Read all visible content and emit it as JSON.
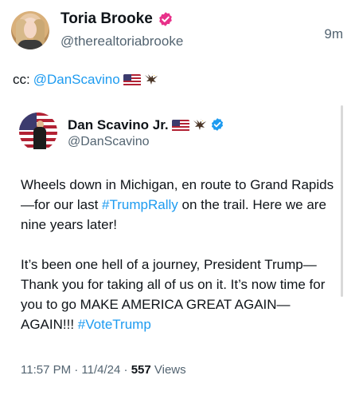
{
  "post": {
    "display_name": "Toria Brooke",
    "handle": "@therealtoriabrooke",
    "time_ago": "9m",
    "badge_color": "#e8318a",
    "text_prefix": "cc: ",
    "mention": "@DanScavino",
    "emoji_flag": "🇺🇸",
    "emoji_eagle": "🦅"
  },
  "quote": {
    "display_name": "Dan Scavino Jr.",
    "handle": "@DanScavino",
    "badge_color": "#1d9bf0",
    "paragraph1": {
      "part1": "Wheels down in Michigan, en route to Grand Rapids—for our last ",
      "hashtag": "#TrumpRally",
      "part2": " on the trail. Here we are nine years later!"
    },
    "paragraph2": {
      "part1": "It’s been one hell of a journey, President Trump—Thank you for taking all of us on it. It’s now time for you to go MAKE AMERICA GREAT AGAIN—AGAIN!!! ",
      "hashtag": "#VoteTrump"
    },
    "timestamp": "11:57 PM · 11/4/24 · ",
    "views_count": "557",
    "views_label": " Views"
  },
  "colors": {
    "link": "#1d9bf0",
    "secondary_text": "#536471",
    "primary_text": "#0f1419"
  }
}
